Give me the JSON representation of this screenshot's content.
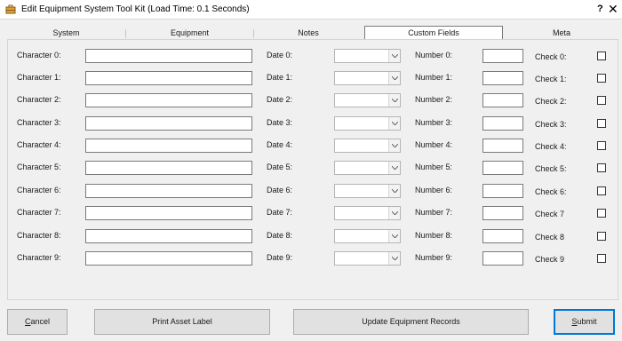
{
  "window": {
    "title": "Edit Equipment System Tool Kit (Load Time: 0.1 Seconds)",
    "help_label": "?",
    "close_label": "✕"
  },
  "tabs": [
    {
      "label": "System",
      "active": false
    },
    {
      "label": "Equipment",
      "active": false
    },
    {
      "label": "Notes",
      "active": false
    },
    {
      "label": "Custom Fields",
      "active": true
    },
    {
      "label": "Meta",
      "active": false
    }
  ],
  "rows": [
    {
      "character_label": "Character 0:",
      "character_value": "",
      "date_label": "Date 0:",
      "date_value": "",
      "number_label": "Number 0:",
      "number_value": "",
      "check_label": "Check 0:",
      "checked": false
    },
    {
      "character_label": "Character 1:",
      "character_value": "",
      "date_label": "Date 1:",
      "date_value": "",
      "number_label": "Number 1:",
      "number_value": "",
      "check_label": "Check 1:",
      "checked": false
    },
    {
      "character_label": "Character 2:",
      "character_value": "",
      "date_label": "Date 2:",
      "date_value": "",
      "number_label": "Number 2:",
      "number_value": "",
      "check_label": "Check 2:",
      "checked": false
    },
    {
      "character_label": "Character 3:",
      "character_value": "",
      "date_label": "Date 3:",
      "date_value": "",
      "number_label": "Number 3:",
      "number_value": "",
      "check_label": "Check 3:",
      "checked": false
    },
    {
      "character_label": "Character 4:",
      "character_value": "",
      "date_label": "Date 4:",
      "date_value": "",
      "number_label": "Number 4:",
      "number_value": "",
      "check_label": "Check 4:",
      "checked": false
    },
    {
      "character_label": "Character 5:",
      "character_value": "",
      "date_label": "Date 5:",
      "date_value": "",
      "number_label": "Number 5:",
      "number_value": "",
      "check_label": "Check 5:",
      "checked": false
    },
    {
      "character_label": "Character 6:",
      "character_value": "",
      "date_label": "Date 6:",
      "date_value": "",
      "number_label": "Number 6:",
      "number_value": "",
      "check_label": "Check 6:",
      "checked": false
    },
    {
      "character_label": "Character 7:",
      "character_value": "",
      "date_label": "Date 7:",
      "date_value": "",
      "number_label": "Number 7:",
      "number_value": "",
      "check_label": "Check 7",
      "checked": false
    },
    {
      "character_label": "Character 8:",
      "character_value": "",
      "date_label": "Date 8:",
      "date_value": "",
      "number_label": "Number 8:",
      "number_value": "",
      "check_label": "Check 8",
      "checked": false
    },
    {
      "character_label": "Character 9:",
      "character_value": "",
      "date_label": "Date 9:",
      "date_value": "",
      "number_label": "Number 9:",
      "number_value": "",
      "check_label": "Check 9",
      "checked": false
    }
  ],
  "buttons": {
    "cancel_mnemonic": "C",
    "cancel_rest": "ancel",
    "print_label": "Print Asset Label",
    "update_label": "Update Equipment Records",
    "submit_mnemonic": "S",
    "submit_rest": "ubmit"
  },
  "colors": {
    "accent": "#0078d7",
    "window_bg": "#f0f0f0",
    "button_bg": "#e1e1e1"
  },
  "icons": {
    "app": "toolkit-app-icon",
    "dropdown": "chevron-down-icon"
  }
}
